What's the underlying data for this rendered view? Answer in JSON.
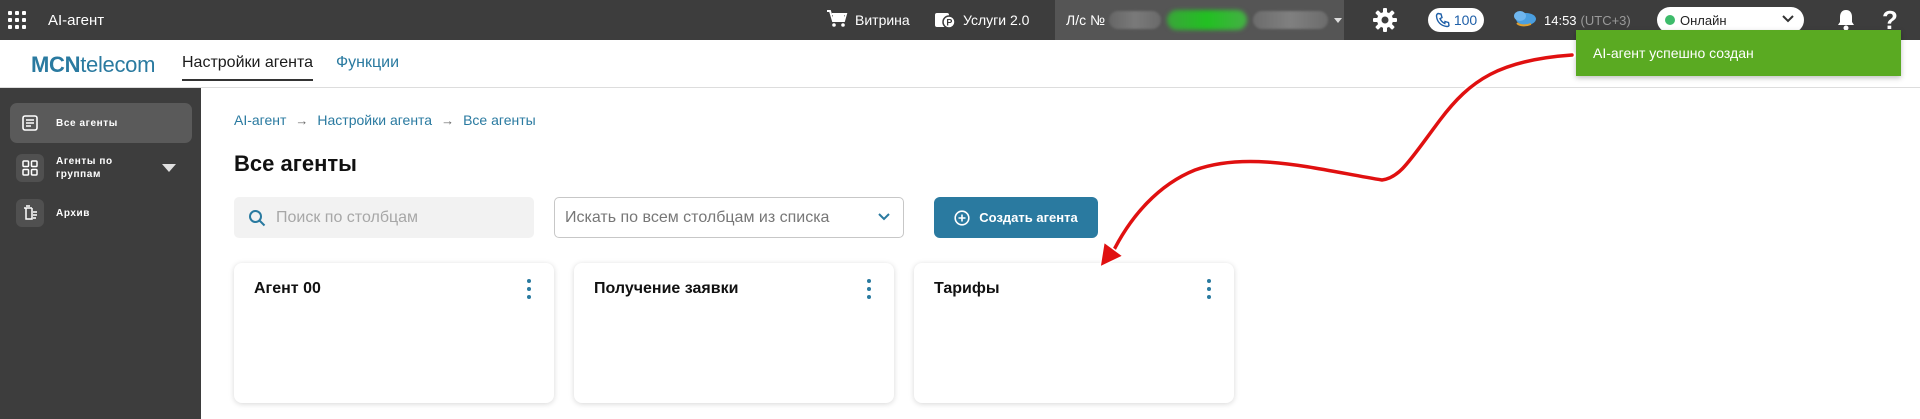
{
  "topbar": {
    "app_title": "AI-агент",
    "vitrina_label": "Витрина",
    "uslugi_label": "Услуги 2.0",
    "account_prefix": "Л/с №",
    "phone_count": "100",
    "time": "14:53",
    "timezone": "(UTC+3)",
    "status_value": "Онлайн",
    "status_color": "#3dbb6a"
  },
  "subheader": {
    "brand_bold": "MCN",
    "brand_rest": "telecom",
    "tabs": [
      {
        "label": "Настройки агента",
        "active": true
      },
      {
        "label": "Функции",
        "active": false
      }
    ]
  },
  "sidebar": {
    "items": [
      {
        "label": "Все агенты",
        "icon": "list-icon",
        "active": true
      },
      {
        "label_line1": "Агенты по",
        "label_line2": "группам",
        "icon": "grid-icon",
        "expandable": true
      },
      {
        "label": "Архив",
        "icon": "archive-icon"
      }
    ]
  },
  "breadcrumb": {
    "items": [
      "AI-агент",
      "Настройки агента",
      "Все агенты"
    ],
    "separator": "→"
  },
  "page": {
    "title": "Все агенты",
    "search_placeholder": "Поиск по столбцам",
    "column_select_value": "Искать по всем столбцам из списка",
    "create_button": "Создать агента"
  },
  "agents": [
    {
      "name": "Агент 00"
    },
    {
      "name": "Получение заявки"
    },
    {
      "name": "Тарифы"
    }
  ],
  "toast": {
    "message": "AI-агент успешно создан",
    "color": "#5aaa22"
  },
  "colors": {
    "accent": "#2a7aa0",
    "topbar": "#3d3d3d",
    "annotation_arrow": "#e01010"
  }
}
